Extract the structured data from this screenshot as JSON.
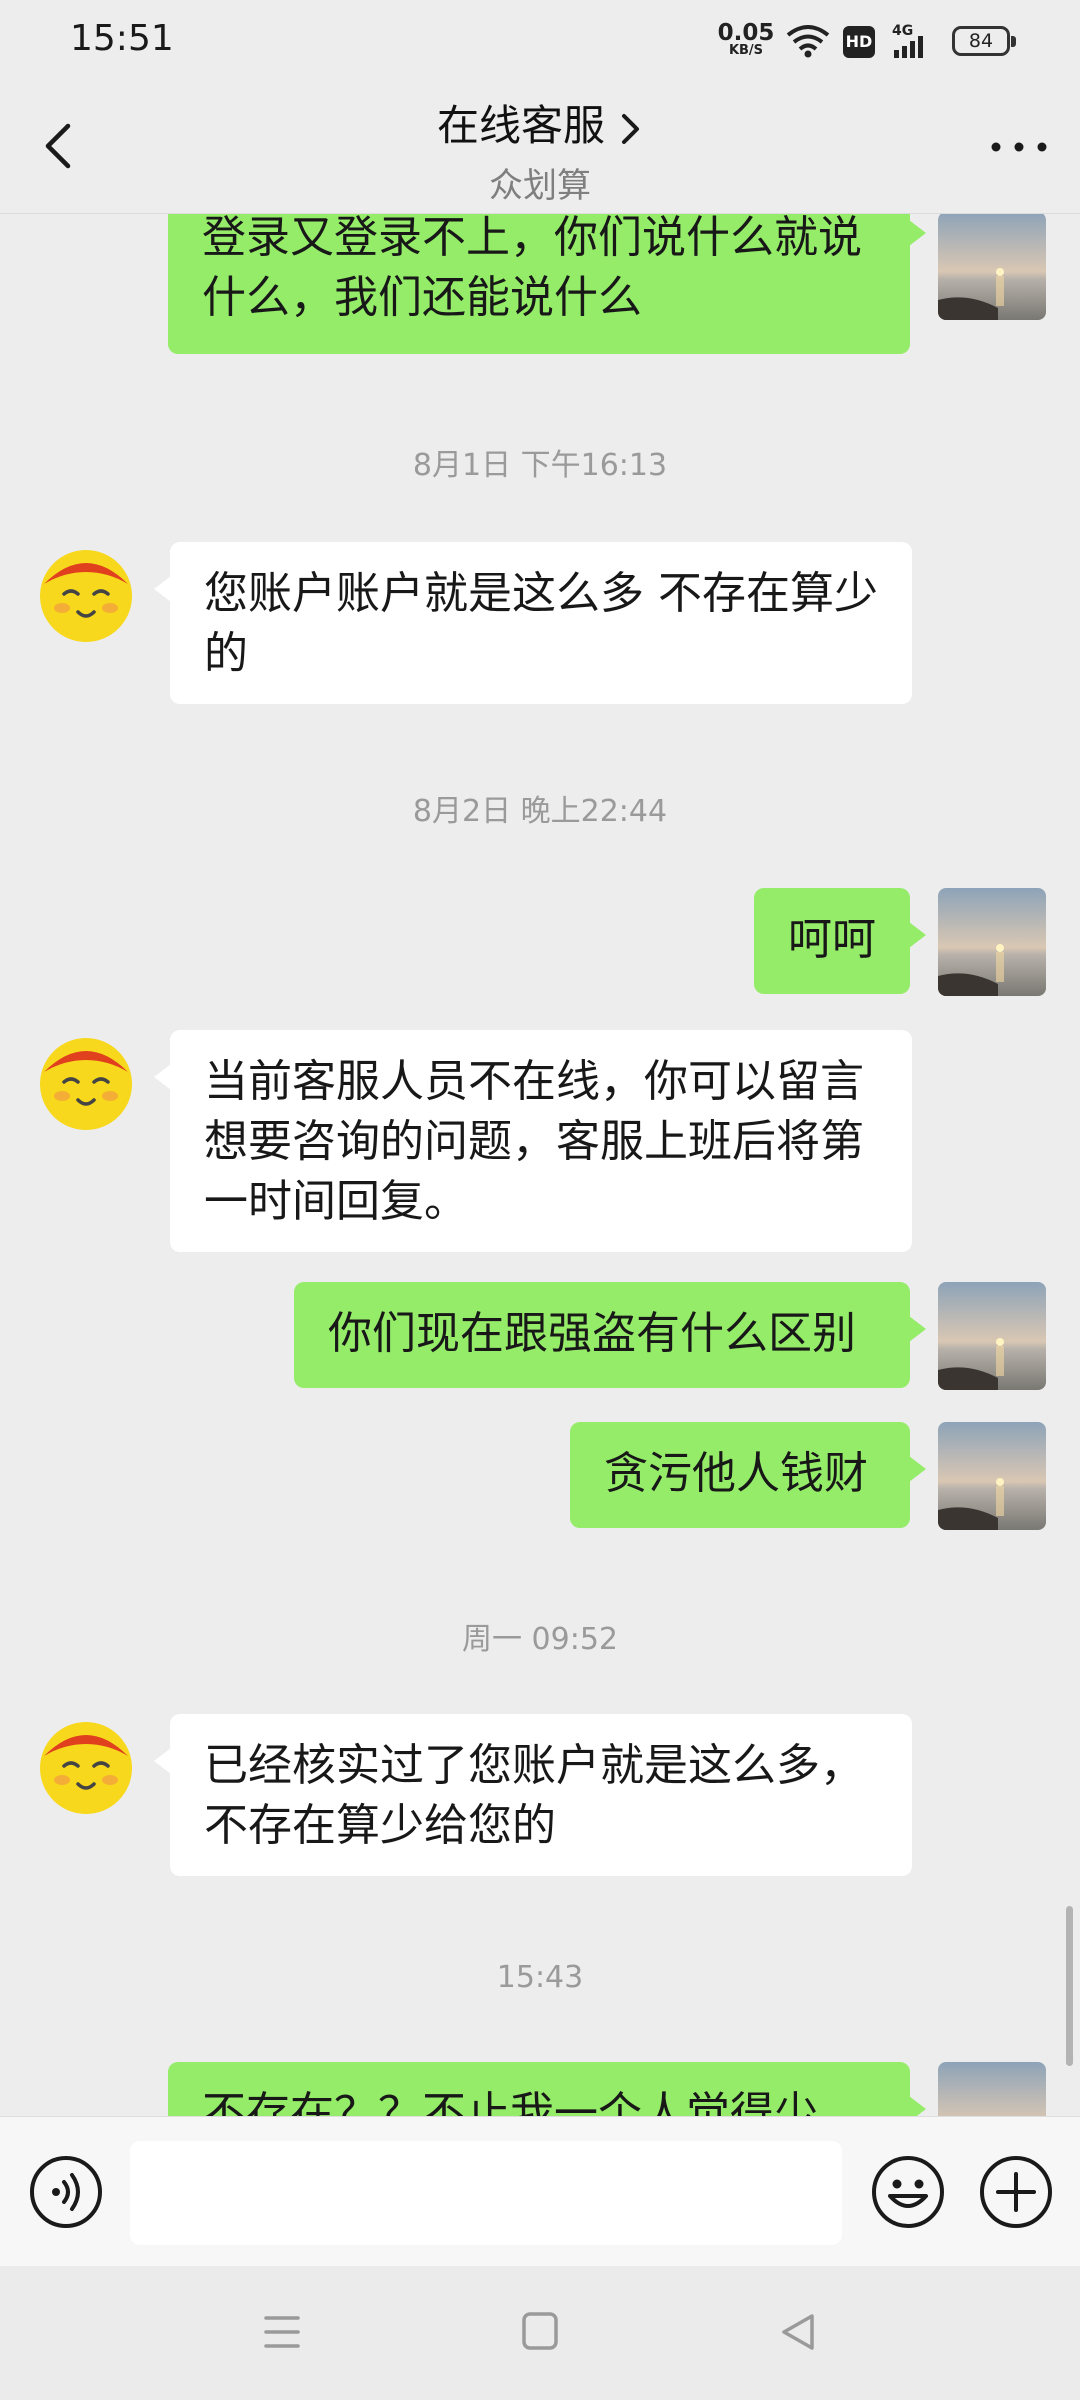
{
  "status_bar": {
    "time": "15:51",
    "net_speed_value": "0.05",
    "net_speed_unit": "KB/S",
    "hd_label": "HD",
    "network_label": "4G",
    "battery": "84"
  },
  "header": {
    "title": "在线客服",
    "subtitle": "众划算"
  },
  "messages": [
    {
      "type": "sent",
      "text": "登录又登录不上，你们说什么就说什么，我们还能说什么"
    },
    {
      "type": "time",
      "text": "8月1日 下午16:13"
    },
    {
      "type": "received",
      "text": "您账户账户就是这么多 不存在算少的"
    },
    {
      "type": "time",
      "text": "8月2日 晚上22:44"
    },
    {
      "type": "sent",
      "text": "呵呵"
    },
    {
      "type": "received",
      "text": "当前客服人员不在线，你可以留言想要咨询的问题，客服上班后将第一时间回复。"
    },
    {
      "type": "sent",
      "text": "你们现在跟强盗有什么区别"
    },
    {
      "type": "sent",
      "text": "贪污他人钱财"
    },
    {
      "type": "time",
      "text": "周一 09:52"
    },
    {
      "type": "received",
      "text": "已经核实过了您账户就是这么多，不存在算少给您的"
    },
    {
      "type": "time",
      "text": "15:43"
    },
    {
      "type": "sent",
      "text": "不存在？？不止我一个人觉得少"
    }
  ],
  "input": {
    "value": "",
    "placeholder": ""
  },
  "colors": {
    "sent_bubble": "#95ec69",
    "received_bubble": "#ffffff",
    "background": "#ededed"
  },
  "icons": {
    "back": "chevron-left-icon",
    "title_chevron": "chevron-right-icon",
    "more": "more-dots-icon",
    "voice": "voice-icon",
    "emoji": "emoji-icon",
    "plus": "plus-icon",
    "nav_menu": "menu-icon",
    "nav_home": "home-icon",
    "nav_back": "back-triangle-icon"
  }
}
